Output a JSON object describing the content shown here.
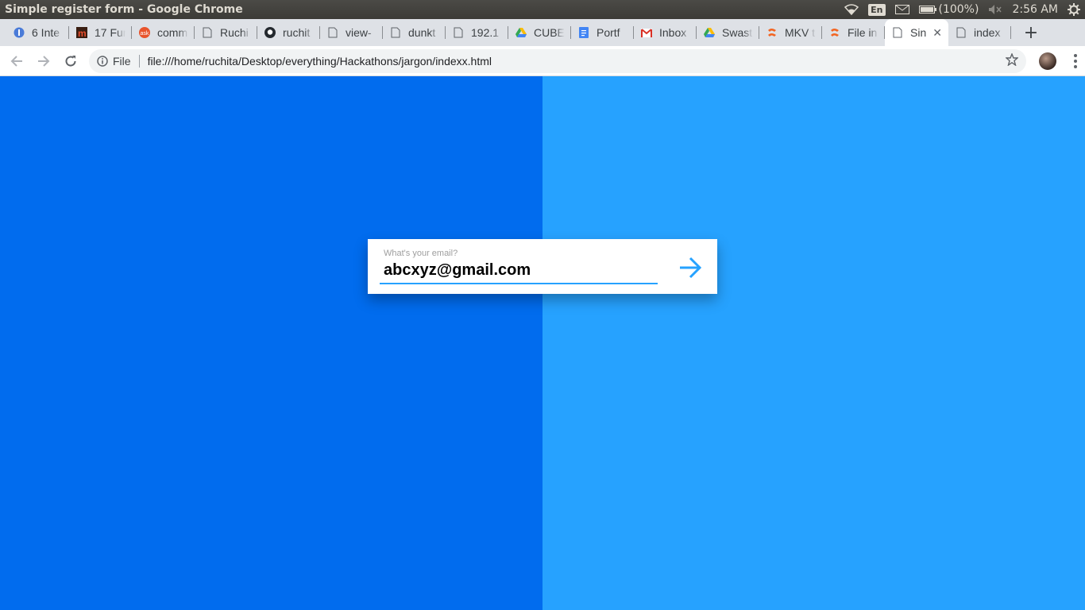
{
  "os": {
    "window_title": "Simple register form - Google Chrome",
    "language": "En",
    "battery": "(100%)",
    "time": "2:56 AM"
  },
  "tabs": [
    {
      "label": "6 Inte",
      "icon": "blue-circle-icon"
    },
    {
      "label": "17 Fur",
      "icon": "m-logo-icon"
    },
    {
      "label": "comm",
      "icon": "ask-logo-icon"
    },
    {
      "label": "Ruchi",
      "icon": "page-icon"
    },
    {
      "label": "ruchit",
      "icon": "github-icon"
    },
    {
      "label": "view-",
      "icon": "page-icon"
    },
    {
      "label": "dunkt",
      "icon": "page-icon"
    },
    {
      "label": "192.1",
      "icon": "page-icon"
    },
    {
      "label": "CUBE",
      "icon": "drive-icon"
    },
    {
      "label": "Portf",
      "icon": "docs-icon"
    },
    {
      "label": "Inbox",
      "icon": "gmail-icon"
    },
    {
      "label": "Swast",
      "icon": "drive-icon"
    },
    {
      "label": "MKV t",
      "icon": "tool-icon"
    },
    {
      "label": "File in",
      "icon": "tool-icon"
    },
    {
      "label": "Sin",
      "icon": "page-icon",
      "active": true
    },
    {
      "label": "index",
      "icon": "page-icon"
    }
  ],
  "toolbar": {
    "scheme_label": "File",
    "url": "file:///home/ruchita/Desktop/everything/Hackathons/jargon/indexx.html"
  },
  "form": {
    "label": "What's your email?",
    "value": "abcxyz@gmail.com"
  },
  "colors": {
    "left_panel": "#016cee",
    "right_panel": "#26a2ff",
    "accent": "#26a2ff"
  }
}
